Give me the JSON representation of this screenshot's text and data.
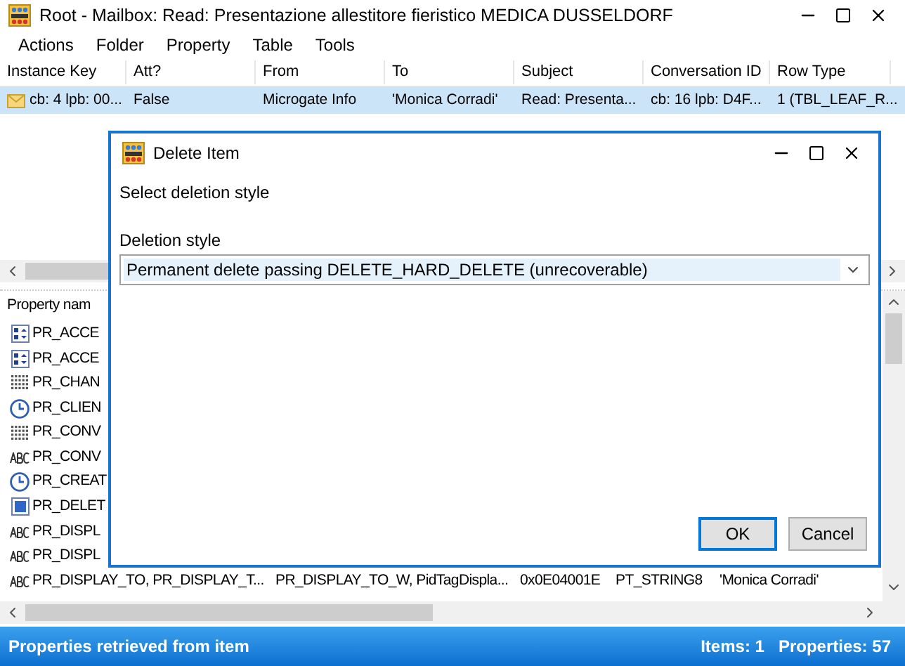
{
  "window": {
    "title": "Root - Mailbox: Read: Presentazione allestitore fieristico MEDICA DUSSELDORF"
  },
  "menu": [
    "Actions",
    "Folder",
    "Property",
    "Table",
    "Tools"
  ],
  "contents_table": {
    "columns": [
      "Instance Key",
      "Att?",
      "From",
      "To",
      "Subject",
      "Conversation ID",
      "Row Type"
    ],
    "rows": [
      {
        "selected": true,
        "cells": [
          "cb: 4 lpb: 00...",
          "False",
          "Microgate Info",
          "'Monica Corradi'",
          "Read: Presenta...",
          "cb: 16 lpb: D4F...",
          "1 (TBL_LEAF_R..."
        ]
      }
    ]
  },
  "property_table": {
    "columns": [
      "Property nam"
    ],
    "rows": [
      {
        "kind": "long",
        "cells": [
          "PR_ACCE"
        ]
      },
      {
        "kind": "long",
        "cells": [
          "PR_ACCE"
        ]
      },
      {
        "kind": "binary",
        "cells": [
          "PR_CHAN"
        ]
      },
      {
        "kind": "time",
        "cells": [
          "PR_CLIEN"
        ]
      },
      {
        "kind": "binary",
        "cells": [
          "PR_CONV"
        ]
      },
      {
        "kind": "string",
        "cells": [
          "PR_CONV"
        ]
      },
      {
        "kind": "time",
        "cells": [
          "PR_CREAT"
        ]
      },
      {
        "kind": "boolean",
        "cells": [
          "PR_DELET"
        ]
      },
      {
        "kind": "string",
        "cells": [
          "PR_DISPL"
        ]
      },
      {
        "kind": "string",
        "cells": [
          "PR_DISPL"
        ]
      },
      {
        "kind": "string",
        "cells": [
          "PR_DISPLAY_TO, PR_DISPLAY_T...",
          "PR_DISPLAY_TO_W, PidTagDispla...",
          "0x0E04001E",
          "PT_STRING8",
          "'Monica Corradi'"
        ]
      }
    ]
  },
  "dialog": {
    "title": "Delete Item",
    "prompt": "Select deletion style",
    "field_label": "Deletion style",
    "value": "Permanent delete passing DELETE_HARD_DELETE (unrecoverable)",
    "buttons": [
      "OK",
      "Cancel"
    ]
  },
  "status_bar": {
    "message": "Properties retrieved from item",
    "items": "Items: 1",
    "properties": "Properties: 57"
  }
}
